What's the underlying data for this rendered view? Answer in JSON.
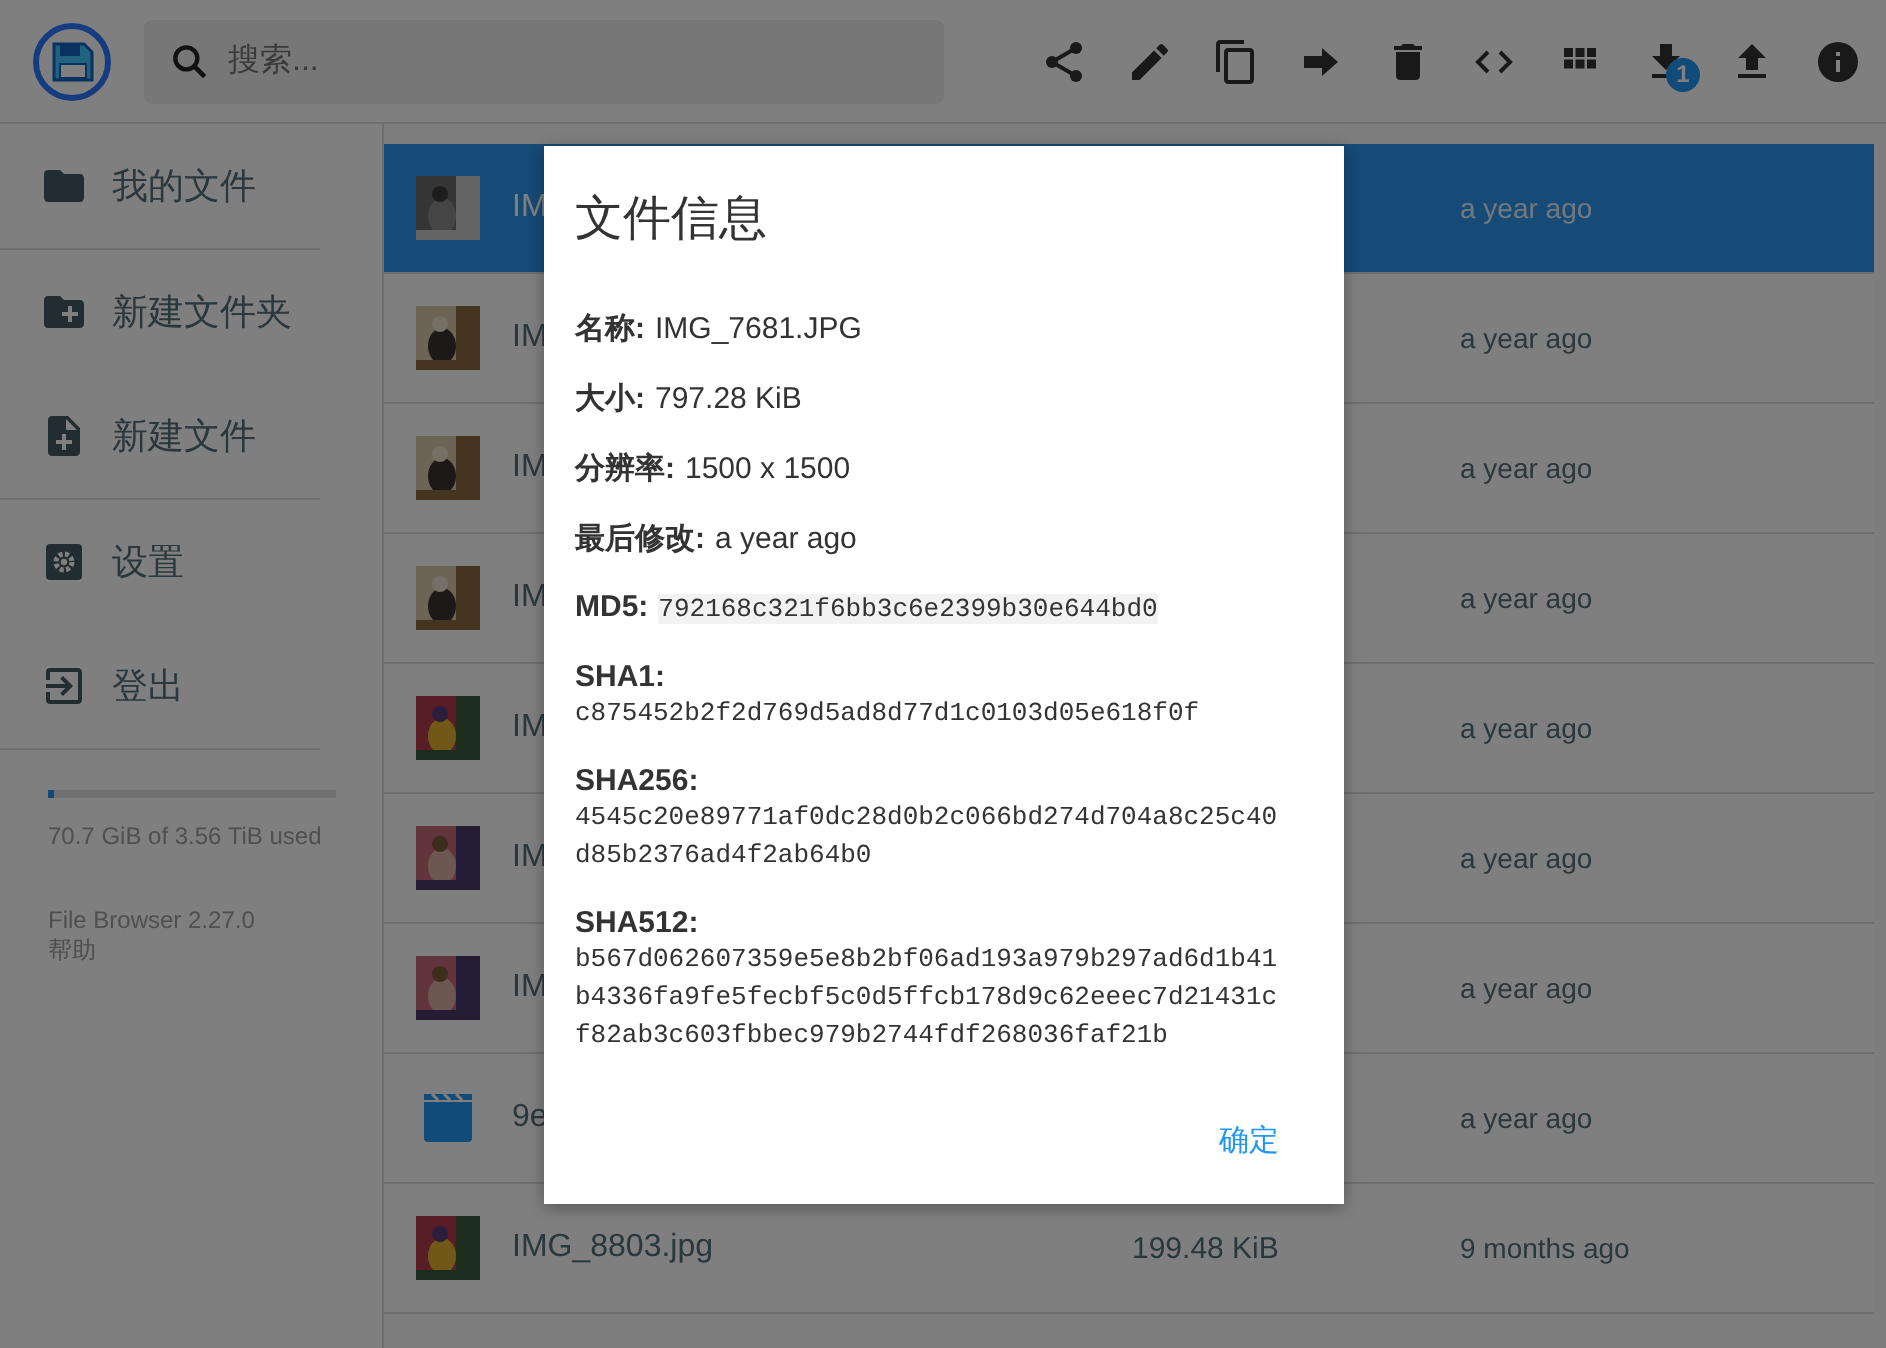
{
  "header": {
    "search": {
      "placeholder": "搜索..."
    },
    "download_badge": "1"
  },
  "sidebar": {
    "sections": [
      {
        "items": [
          {
            "kind": "folder",
            "label": "我的文件"
          }
        ]
      },
      {
        "items": [
          {
            "kind": "new-folder",
            "label": "新建文件夹"
          },
          {
            "kind": "new-file",
            "label": "新建文件"
          }
        ]
      },
      {
        "items": [
          {
            "kind": "settings",
            "label": "设置"
          },
          {
            "kind": "logout",
            "label": "登出"
          }
        ]
      }
    ],
    "storage": {
      "level": 0.02,
      "text": "70.7 GiB of 3.56 TiB used"
    },
    "version": "File Browser 2.27.0",
    "help": "帮助"
  },
  "files": [
    {
      "kind": "picture",
      "name": "IM",
      "modified": "a year ago",
      "selected": true
    },
    {
      "kind": "picture",
      "name": "IM",
      "modified": "a year ago",
      "selected": false
    },
    {
      "kind": "picture",
      "name": "IM",
      "modified": "a year ago",
      "selected": false
    },
    {
      "kind": "picture",
      "name": "IM",
      "modified": "a year ago",
      "selected": false
    },
    {
      "kind": "picture",
      "name": "IM",
      "modified": "a year ago",
      "selected": false
    },
    {
      "kind": "picture",
      "name": "IM",
      "modified": "a year ago",
      "selected": false
    },
    {
      "kind": "picture",
      "name": "IM",
      "modified": "a year ago",
      "selected": false
    },
    {
      "kind": "video",
      "name": "9e",
      "modified": "a year ago",
      "selected": false
    },
    {
      "kind": "picture",
      "name": "IMG_8803.jpg",
      "size": "199.48 KiB",
      "modified": "9 months ago",
      "selected": false
    }
  ],
  "dialog": {
    "title": "文件信息",
    "fields": [
      {
        "label": "名称:",
        "value": "IMG_7681.JPG",
        "kind": "plain"
      },
      {
        "label": "大小:",
        "value": "797.28 KiB",
        "kind": "plain"
      },
      {
        "label": "分辨率:",
        "value": "1500 x 1500",
        "kind": "plain"
      },
      {
        "label": "最后修改:",
        "value": "a year ago",
        "kind": "plain"
      },
      {
        "label": "MD5:",
        "value": "792168c321f6bb3c6e2399b30e644bd0",
        "kind": "hash-inline"
      },
      {
        "label": "SHA1:",
        "value": "c875452b2f2d769d5ad8d77d1c0103d05e618f0f",
        "kind": "hash-block"
      },
      {
        "label": "SHA256:",
        "value": "4545c20e89771af0dc28d0b2c066bd274d704a8c25c40d85b2376ad4f2ab64b0",
        "kind": "hash-block"
      },
      {
        "label": "SHA512:",
        "value": "b567d062607359e5e8b2bf06ad193a979b297ad6d1b41b4336fa9fe5fecbf5c0d5ffcb178d9c62eeec7d21431cf82ab3c603fbbec979b2744fdf268036faf21b",
        "kind": "hash-block"
      }
    ],
    "button": "确定"
  }
}
